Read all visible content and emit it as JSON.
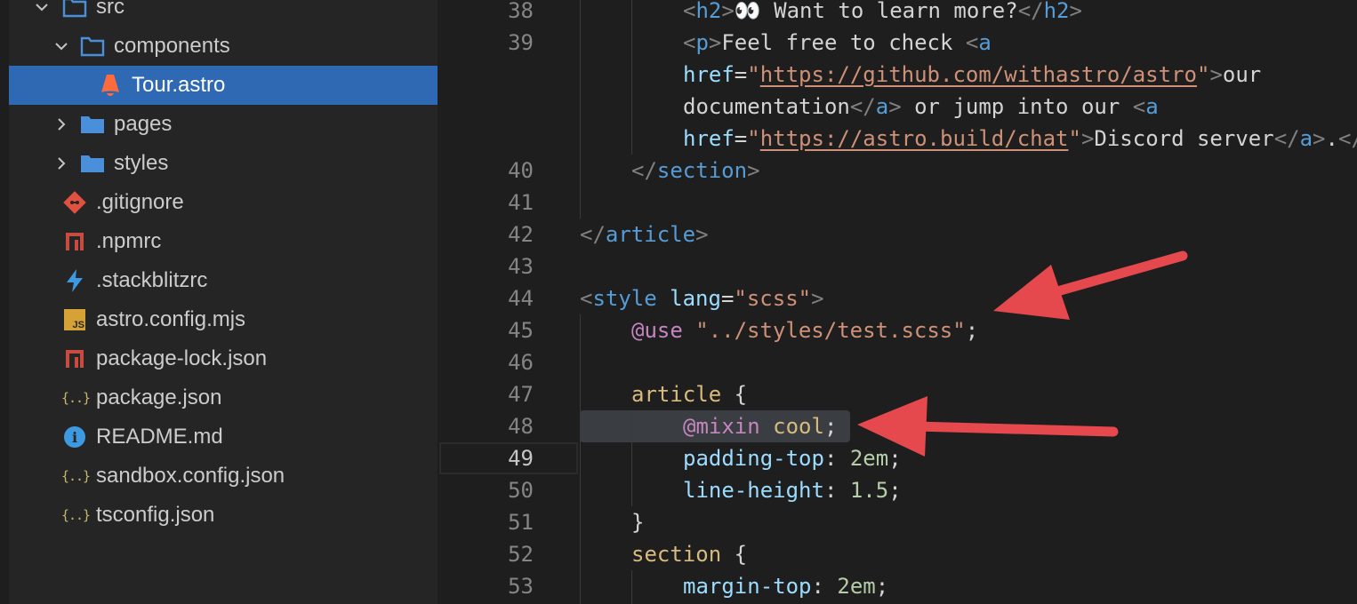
{
  "explorer": {
    "items": [
      {
        "label": "src",
        "icon": "folder-icon",
        "expanded": true
      },
      {
        "label": "components",
        "icon": "folder-icon",
        "expanded": true
      },
      {
        "label": "Tour.astro",
        "icon": "astro-icon",
        "selected": true
      },
      {
        "label": "pages",
        "icon": "folder-icon",
        "expanded": false
      },
      {
        "label": "styles",
        "icon": "folder-icon",
        "expanded": false
      },
      {
        "label": ".gitignore",
        "icon": "git-icon"
      },
      {
        "label": ".npmrc",
        "icon": "npm-icon"
      },
      {
        "label": ".stackblitzrc",
        "icon": "lightning-icon"
      },
      {
        "label": "astro.config.mjs",
        "icon": "js-icon",
        "icon_text": "JS"
      },
      {
        "label": "package-lock.json",
        "icon": "npm-icon"
      },
      {
        "label": "package.json",
        "icon": "json-braces-icon",
        "icon_text": "{..}"
      },
      {
        "label": "README.md",
        "icon": "info-icon",
        "icon_text": "i"
      },
      {
        "label": "sandbox.config.json",
        "icon": "json-braces-icon",
        "icon_text": "{..}"
      },
      {
        "label": "tsconfig.json",
        "icon": "json-braces-icon",
        "icon_text": "{..}"
      }
    ]
  },
  "editor": {
    "active_line": "49",
    "highlighted_line": "48",
    "lines": [
      {
        "n": "38",
        "tokens": [
          [
            "brk",
            "<"
          ],
          [
            "tag",
            "h2"
          ],
          [
            "brk",
            ">"
          ],
          [
            "text",
            "👀 Want to learn more?"
          ],
          [
            "brk",
            "</"
          ],
          [
            "tag",
            "h2"
          ],
          [
            "brk",
            ">"
          ]
        ]
      },
      {
        "n": "39",
        "tokens": [
          [
            "brk",
            "<"
          ],
          [
            "tag",
            "p"
          ],
          [
            "brk",
            ">"
          ],
          [
            "text",
            "Feel free to check "
          ],
          [
            "brk",
            "<"
          ],
          [
            "tag",
            "a"
          ]
        ]
      },
      {
        "n": "",
        "tokens": [
          [
            "attr",
            "href"
          ],
          [
            "plain",
            "="
          ],
          [
            "str",
            "\""
          ],
          [
            "link",
            "https://github.com/withastro/astro"
          ],
          [
            "str",
            "\""
          ],
          [
            "brk",
            ">"
          ],
          [
            "text",
            "our"
          ]
        ]
      },
      {
        "n": "",
        "tokens": [
          [
            "text",
            "documentation"
          ],
          [
            "brk",
            "</"
          ],
          [
            "tag",
            "a"
          ],
          [
            "brk",
            ">"
          ],
          [
            "text",
            " or jump into our "
          ],
          [
            "brk",
            "<"
          ],
          [
            "tag",
            "a"
          ]
        ]
      },
      {
        "n": "",
        "tokens": [
          [
            "attr",
            "href"
          ],
          [
            "plain",
            "="
          ],
          [
            "str",
            "\""
          ],
          [
            "link",
            "https://astro.build/chat"
          ],
          [
            "str",
            "\""
          ],
          [
            "brk",
            ">"
          ],
          [
            "text",
            "Discord server"
          ],
          [
            "brk",
            "</"
          ],
          [
            "tag",
            "a"
          ],
          [
            "brk",
            ">"
          ],
          [
            "text",
            "."
          ],
          [
            "brk",
            "</"
          ]
        ]
      },
      {
        "n": "40",
        "tokens": [
          [
            "brk",
            "</"
          ],
          [
            "tag",
            "section"
          ],
          [
            "brk",
            ">"
          ]
        ]
      },
      {
        "n": "41",
        "tokens": []
      },
      {
        "n": "42",
        "tokens": [
          [
            "brk",
            "</"
          ],
          [
            "tag",
            "article"
          ],
          [
            "brk",
            ">"
          ]
        ]
      },
      {
        "n": "43",
        "tokens": []
      },
      {
        "n": "44",
        "tokens": [
          [
            "brk",
            "<"
          ],
          [
            "tag",
            "style"
          ],
          [
            "plain",
            " "
          ],
          [
            "attr",
            "lang"
          ],
          [
            "plain",
            "="
          ],
          [
            "str",
            "\"scss\""
          ],
          [
            "brk",
            ">"
          ]
        ]
      },
      {
        "n": "45",
        "tokens": [
          [
            "at",
            "@use"
          ],
          [
            "plain",
            " "
          ],
          [
            "str",
            "\"../styles/test.scss\""
          ],
          [
            "plain",
            ";"
          ]
        ]
      },
      {
        "n": "46",
        "tokens": []
      },
      {
        "n": "47",
        "tokens": [
          [
            "sel",
            "article"
          ],
          [
            "plain",
            " {"
          ]
        ]
      },
      {
        "n": "48",
        "tokens": [
          [
            "at",
            "@mixin"
          ],
          [
            "plain",
            " "
          ],
          [
            "sel",
            "cool"
          ],
          [
            "plain",
            ";"
          ]
        ]
      },
      {
        "n": "49",
        "tokens": [
          [
            "prop",
            "padding-top"
          ],
          [
            "plain",
            ": "
          ],
          [
            "num",
            "2em"
          ],
          [
            "plain",
            ";"
          ]
        ]
      },
      {
        "n": "50",
        "tokens": [
          [
            "prop",
            "line-height"
          ],
          [
            "plain",
            ": "
          ],
          [
            "num",
            "1.5"
          ],
          [
            "plain",
            ";"
          ]
        ]
      },
      {
        "n": "51",
        "tokens": [
          [
            "plain",
            "}"
          ]
        ]
      },
      {
        "n": "52",
        "tokens": [
          [
            "sel",
            "section"
          ],
          [
            "plain",
            " {"
          ]
        ]
      },
      {
        "n": "53",
        "tokens": [
          [
            "prop",
            "margin-top"
          ],
          [
            "plain",
            ": "
          ],
          [
            "num",
            "2em"
          ],
          [
            "plain",
            ";"
          ]
        ]
      }
    ]
  },
  "colors": {
    "selection": "#2f69b3",
    "arrow": "#e5484d",
    "folder": "#4a8fd9",
    "astro": "#ff6b3d",
    "git": "#e0513f",
    "npm": "#c94a3e",
    "js_badge": "#d6a236",
    "json": "#c5ba6b",
    "info": "#3e9ae0"
  }
}
